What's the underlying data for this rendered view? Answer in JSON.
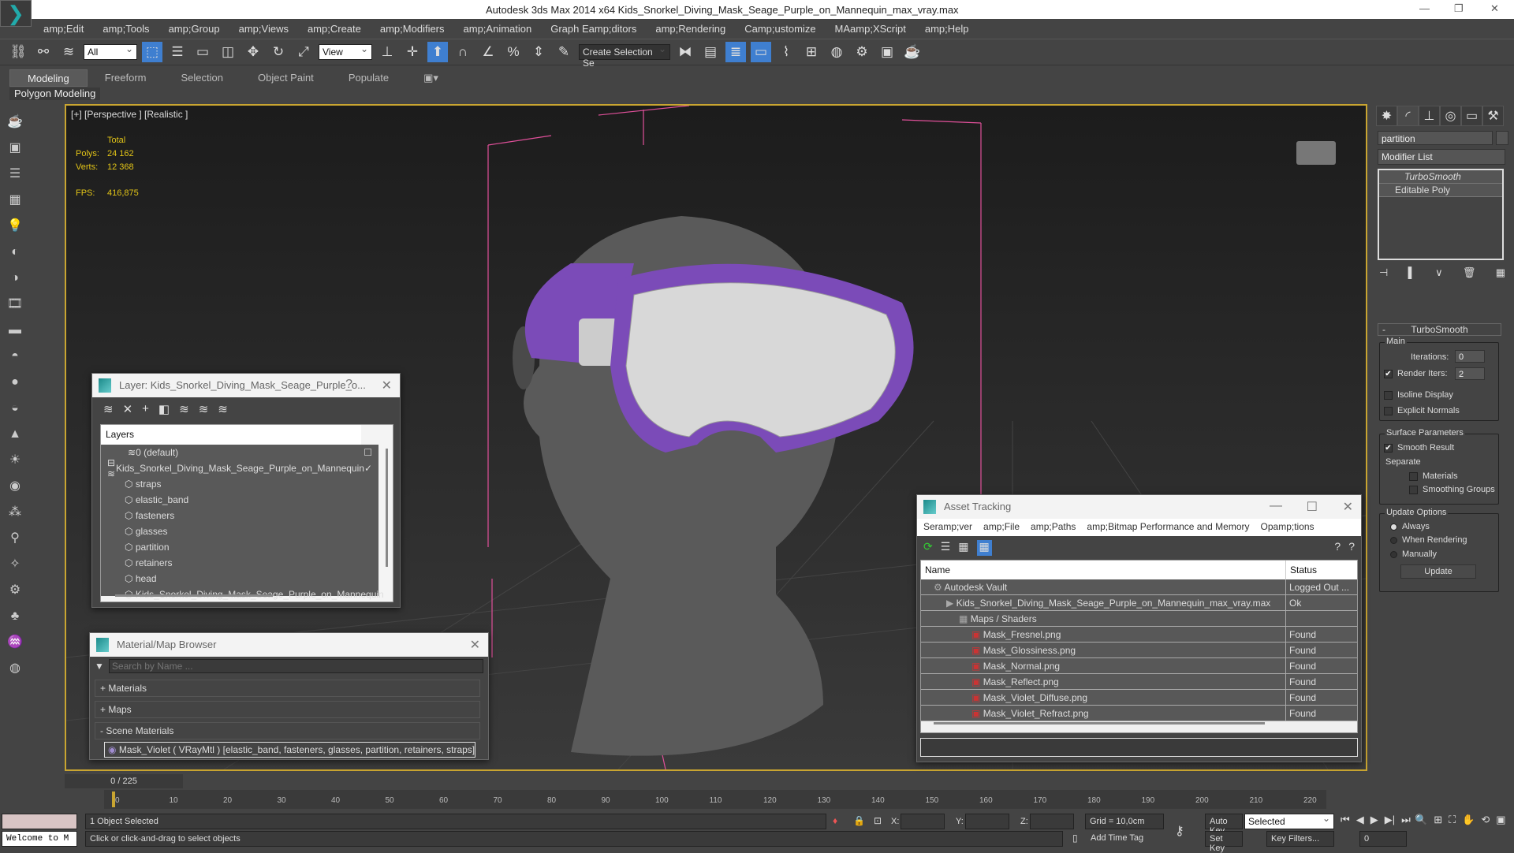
{
  "title": "Autodesk 3ds Max  2014 x64    Kids_Snorkel_Diving_Mask_Seage_Purple_on_Mannequin_max_vray.max",
  "menu": [
    "amp;Edit",
    "amp;Tools",
    "amp;Group",
    "amp;Views",
    "amp;Create",
    "amp;Modifiers",
    "amp;Animation",
    "Graph Eamp;ditors",
    "amp;Rendering",
    "Camp;ustomize",
    "MAamp;XScript",
    "amp;Help"
  ],
  "toolbar": {
    "filter": "All",
    "refcoord": "View",
    "selset": "Create Selection Se"
  },
  "ribbon": {
    "tabs": [
      "Modeling",
      "Freeform",
      "Selection",
      "Object Paint",
      "Populate"
    ],
    "sub": "Polygon Modeling"
  },
  "viewport": {
    "label": "[+] [Perspective ] [Realistic ]",
    "total": "Total",
    "polys_label": "Polys:",
    "polys": "24 162",
    "verts_label": "Verts:",
    "verts": "12 368",
    "fps_label": "FPS:",
    "fps": "416,875"
  },
  "command_panel": {
    "object_name": "partition",
    "modifier_list": "Modifier List",
    "stack": [
      "TurboSmooth",
      "Editable Poly"
    ],
    "rollout": "TurboSmooth",
    "main": "Main",
    "iterations_label": "Iterations:",
    "iterations": "0",
    "render_iters_label": "Render Iters:",
    "render_iters": "2",
    "isoline": "Isoline Display",
    "explicit": "Explicit Normals",
    "surface": "Surface Parameters",
    "smooth_result": "Smooth Result",
    "separate": "Separate",
    "materials": "Materials",
    "smoothing_groups": "Smoothing Groups",
    "update_options": "Update Options",
    "always": "Always",
    "when_rendering": "When Rendering",
    "manually": "Manually",
    "update": "Update",
    "minus": "-"
  },
  "layer_dialog": {
    "title": "Layer: Kids_Snorkel_Diving_Mask_Seage_Purple_o...",
    "help": "?",
    "header": "Layers",
    "default_layer": "0 (default)",
    "layer": "Kids_Snorkel_Diving_Mask_Seage_Purple_on_Mannequin",
    "objects": [
      "straps",
      "elastic_band",
      "fasteners",
      "glasses",
      "partition",
      "retainers",
      "head",
      "Kids_Snorkel_Diving_Mask_Seage_Purple_on_Mannequin"
    ]
  },
  "material_browser": {
    "title": "Material/Map Browser",
    "search_placeholder": "Search by Name ...",
    "sections": [
      "+ Materials",
      "+ Maps",
      "- Scene Materials"
    ],
    "material": "Mask_Violet ( VRayMtl ) [elastic_band, fasteners, glasses, partition, retainers, straps]"
  },
  "asset_tracking": {
    "title": "Asset Tracking",
    "menu": [
      "Seramp;ver",
      "amp;File",
      "amp;Paths",
      "amp;Bitmap Performance and Memory",
      "Opamp;tions"
    ],
    "col_name": "Name",
    "col_status": "Status",
    "rows": [
      {
        "name": "Autodesk Vault",
        "status": "Logged Out ...",
        "level": 1
      },
      {
        "name": "Kids_Snorkel_Diving_Mask_Seage_Purple_on_Mannequin_max_vray.max",
        "status": "Ok",
        "level": 2
      },
      {
        "name": "Maps / Shaders",
        "status": "",
        "level": 3
      },
      {
        "name": "Mask_Fresnel.png",
        "status": "Found",
        "level": 4
      },
      {
        "name": "Mask_Glossiness.png",
        "status": "Found",
        "level": 4
      },
      {
        "name": "Mask_Normal.png",
        "status": "Found",
        "level": 4
      },
      {
        "name": "Mask_Reflect.png",
        "status": "Found",
        "level": 4
      },
      {
        "name": "Mask_Violet_Diffuse.png",
        "status": "Found",
        "level": 4
      },
      {
        "name": "Mask_Violet_Refract.png",
        "status": "Found",
        "level": 4
      }
    ]
  },
  "timeline": {
    "frame": "0 / 225",
    "ticks": [
      "0",
      "10",
      "20",
      "30",
      "40",
      "50",
      "60",
      "70",
      "80",
      "90",
      "100",
      "110",
      "120",
      "130",
      "140",
      "150",
      "160",
      "170",
      "180",
      "190",
      "200",
      "210",
      "220"
    ]
  },
  "status": {
    "selected": "1 Object Selected",
    "prompt": "Click or click-and-drag to select objects",
    "x": "X:",
    "y": "Y:",
    "z": "Z:",
    "grid": "Grid = 10,0cm",
    "auto_key": "Auto Key",
    "set_key": "Set Key",
    "key_mode": "Selected",
    "key_filters": "Key Filters...",
    "frame_field": "0",
    "add_time_tag": "Add Time Tag",
    "welcome": "Welcome to M"
  },
  "colors": {
    "accent": "#3f7fd0",
    "viewport_border": "#c9a531",
    "mask": "#7b4bb8",
    "stats": "#e2c417"
  }
}
